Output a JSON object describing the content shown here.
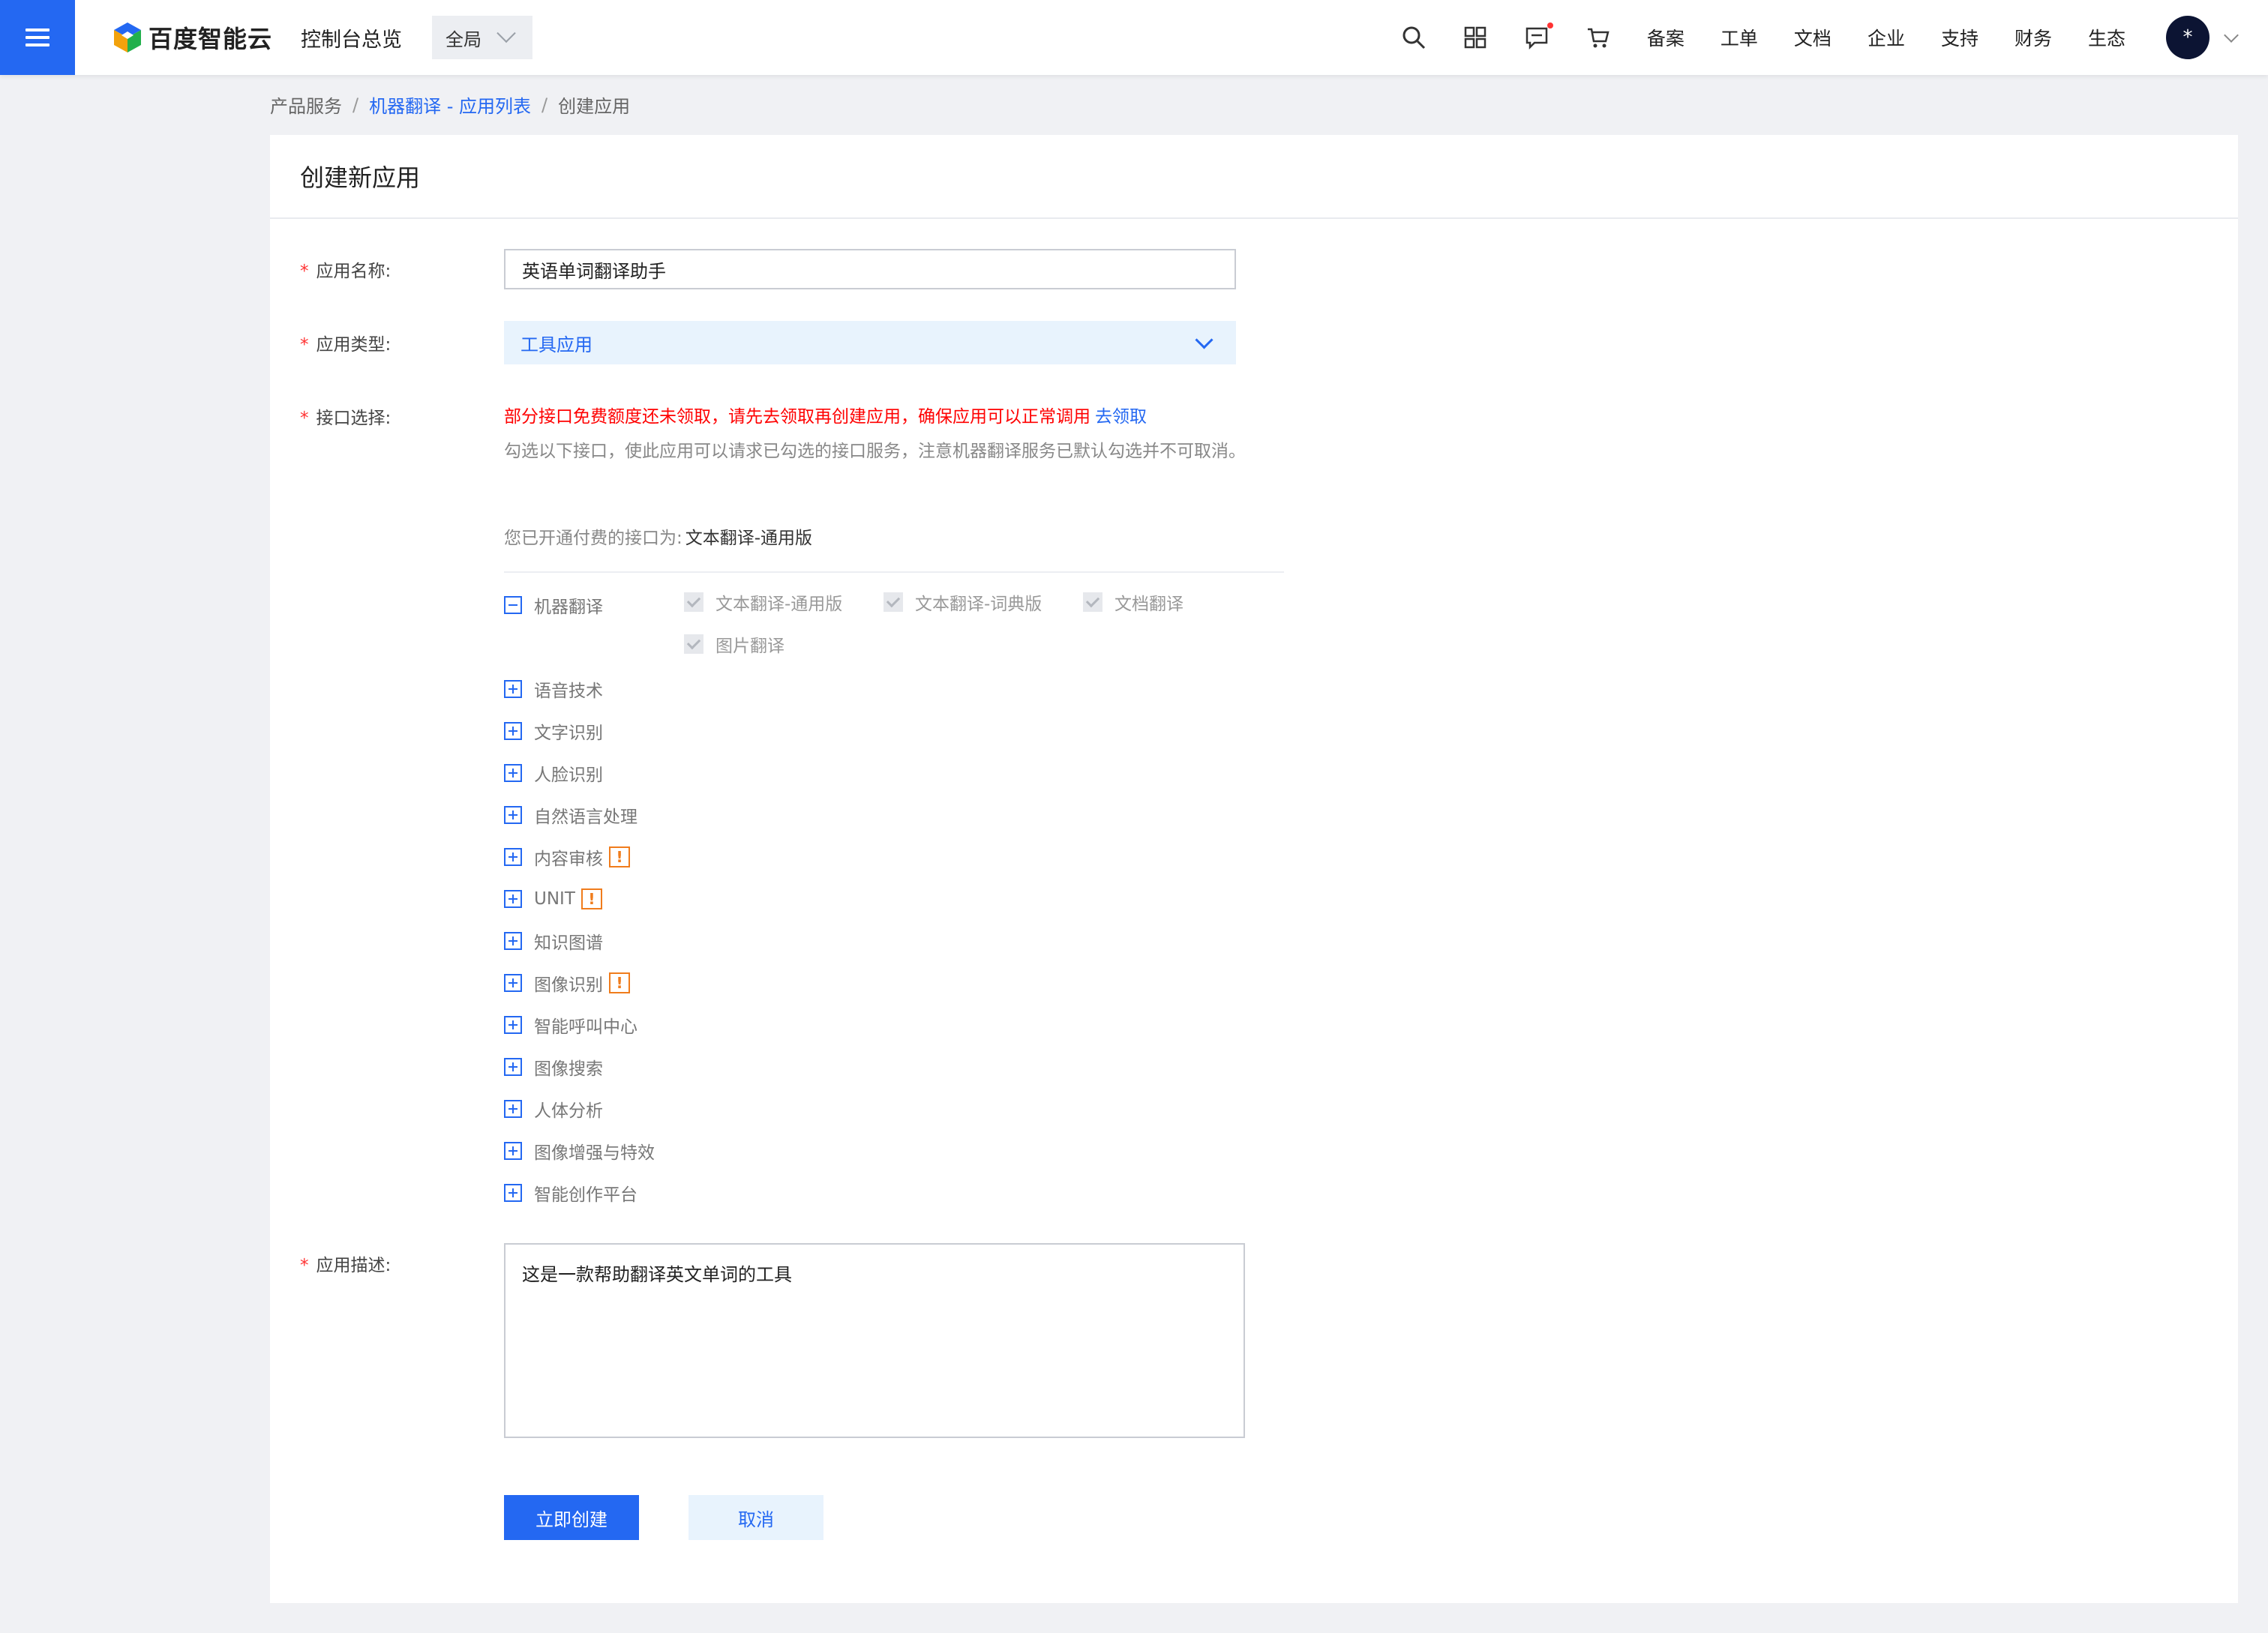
{
  "topbar": {
    "logo_text": "百度智能云",
    "console_title": "控制台总览",
    "region": "全局",
    "nav": [
      "备案",
      "工单",
      "文档",
      "企业",
      "支持",
      "财务",
      "生态"
    ],
    "avatar_text": "*",
    "icons": [
      "search-icon",
      "grid-icon",
      "message-icon",
      "cart-icon"
    ]
  },
  "breadcrumb": {
    "root": "产品服务",
    "link": "机器翻译 - 应用列表",
    "current": "创建应用",
    "sep": "/"
  },
  "card": {
    "title": "创建新应用"
  },
  "form": {
    "name_label": "应用名称:",
    "name_value": "英语单词翻译助手",
    "type_label": "应用类型:",
    "type_value": "工具应用",
    "api_label": "接口选择:",
    "required_mark": "*",
    "warning": "部分接口免费额度还未领取，请先去领取再创建应用，确保应用可以正常调用",
    "warning_link": "去领取",
    "hint": "勾选以下接口，使此应用可以请求已勾选的接口服务，注意机器翻译服务已默认勾选并不可取消。",
    "paid_label": "您已开通付费的接口为:",
    "paid_value": "文本翻译-通用版",
    "desc_label": "应用描述:",
    "desc_value": "这是一款帮助翻译英文单词的工具",
    "submit": "立即创建",
    "cancel": "取消"
  },
  "api_tree": {
    "expanded_group": "机器翻译",
    "expanded_items": [
      "文本翻译-通用版",
      "文本翻译-词典版",
      "文档翻译",
      "图片翻译"
    ],
    "groups": [
      {
        "label": "语音技术",
        "warn": ""
      },
      {
        "label": "文字识别",
        "warn": ""
      },
      {
        "label": "人脸识别",
        "warn": ""
      },
      {
        "label": "自然语言处理",
        "warn": ""
      },
      {
        "label": "内容审核",
        "warn": "!"
      },
      {
        "label": "UNIT",
        "warn": "!"
      },
      {
        "label": "知识图谱",
        "warn": ""
      },
      {
        "label": "图像识别",
        "warn": "!"
      },
      {
        "label": "智能呼叫中心",
        "warn": ""
      },
      {
        "label": "图像搜索",
        "warn": ""
      },
      {
        "label": "人体分析",
        "warn": ""
      },
      {
        "label": "图像增强与特效",
        "warn": ""
      },
      {
        "label": "智能创作平台",
        "warn": ""
      }
    ]
  },
  "colors": {
    "brand": "#2468f2",
    "warning": "#ff0000",
    "badge": "#f07c1c"
  }
}
